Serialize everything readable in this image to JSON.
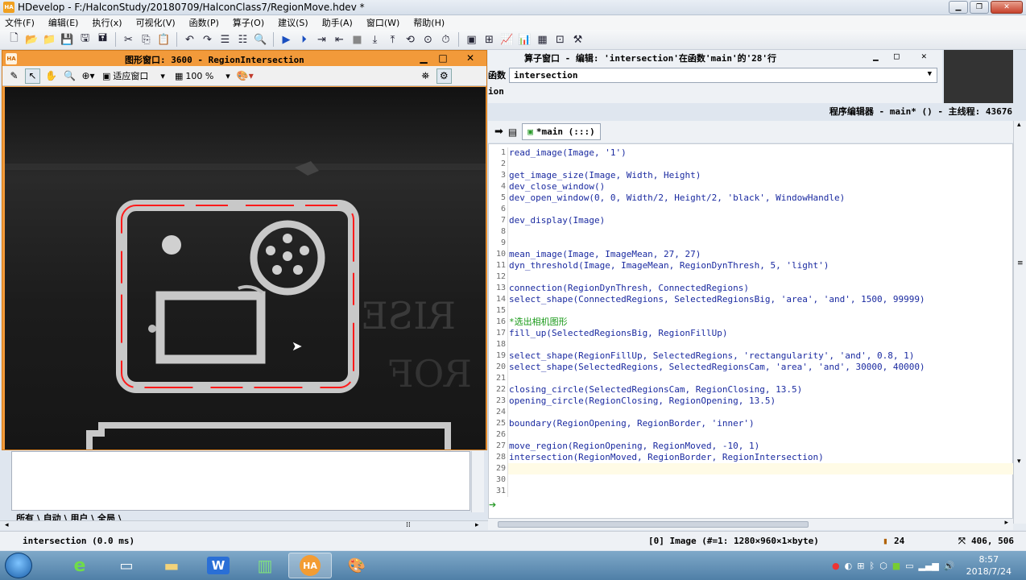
{
  "app": {
    "title": "HDevelop - F:/HalconStudy/20180709/HalconClass7/RegionMove.hdev *",
    "icon_label": "HA"
  },
  "menu": [
    "文件(F)",
    "编辑(E)",
    "执行(x)",
    "可视化(V)",
    "函数(P)",
    "算子(O)",
    "建议(S)",
    "助手(A)",
    "窗口(W)",
    "帮助(H)"
  ],
  "graphics_window": {
    "title": "图形窗口: 3600 - RegionIntersection",
    "fit_label": "适应窗口",
    "zoom_label": "100 %",
    "region_color": "#ff1a1a"
  },
  "operator_window": {
    "title": "算子窗口 - 编辑: 'intersection'在函数'main'的'28'行",
    "label": "函数",
    "selected": "intersection",
    "cut_text": "ion"
  },
  "program_editor": {
    "title": "程序编辑器 - main* () - 主线程: 43676",
    "proc_tab": "*main (:::)",
    "lines": [
      "read_image(Image, '1')",
      "",
      "get_image_size(Image, Width, Height)",
      "dev_close_window()",
      "dev_open_window(0, 0, Width/2, Height/2, 'black', WindowHandle)",
      "",
      "dev_display(Image)",
      "",
      "",
      "mean_image(Image, ImageMean, 27, 27)",
      "dyn_threshold(Image, ImageMean, RegionDynThresh, 5, 'light')",
      "",
      "connection(RegionDynThresh, ConnectedRegions)",
      "select_shape(ConnectedRegions, SelectedRegionsBig, 'area', 'and', 1500, 99999)",
      "",
      "*选出相机图形",
      "fill_up(SelectedRegionsBig, RegionFillUp)",
      "",
      "select_shape(RegionFillUp, SelectedRegions, 'rectangularity', 'and', 0.8, 1)",
      "select_shape(SelectedRegions, SelectedRegionsCam, 'area', 'and', 30000, 40000)",
      "",
      "closing_circle(SelectedRegionsCam, RegionClosing, 13.5)",
      "opening_circle(RegionClosing, RegionOpening, 13.5)",
      "",
      "boundary(RegionOpening, RegionBorder, 'inner')",
      "",
      "move_region(RegionOpening, RegionMoved, -10, 1)",
      "intersection(RegionMoved, RegionBorder, RegionIntersection)",
      "",
      "",
      ""
    ],
    "line_numbers": [
      "1",
      "2",
      "3",
      "4",
      "5",
      "6",
      "7",
      "8",
      "9",
      "10",
      "11",
      "12",
      "13",
      "14",
      "15",
      "16",
      "17",
      "18",
      "19",
      "20",
      "21",
      "22",
      "23",
      "24",
      "25",
      "26",
      "27",
      "28",
      "29",
      "30",
      "31"
    ]
  },
  "output_tabs": "所有 \\ 自动 \\ 用户 \\ 全局 \\",
  "status": {
    "message": "intersection (0.0 ms)",
    "image_info": "[0] Image (#=1: 1280×960×1×byte)",
    "value": "24",
    "coords": "406, 506"
  },
  "taskbar": {
    "tasks": [
      "ie-icon",
      "desktop-icon",
      "folder-icon",
      "word-icon",
      "app-icon",
      "halcon-icon",
      "paint-icon"
    ],
    "halcon_label": "HA",
    "word_label": "W",
    "time": "8:57",
    "date": "2018/7/24"
  }
}
